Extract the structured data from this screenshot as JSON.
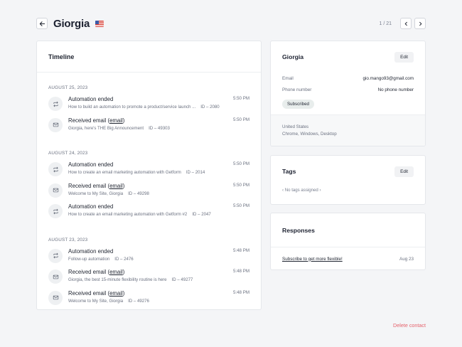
{
  "header": {
    "name": "Giorgia",
    "pager": "1 / 21"
  },
  "icons": {
    "back": "arrow-left-icon",
    "prev": "chevron-left-icon",
    "next": "chevron-right-icon",
    "automation": "repeat-icon",
    "email": "mail-icon",
    "flag": "us-flag-icon"
  },
  "timeline": {
    "title": "Timeline",
    "days": [
      {
        "label": "AUGUST 25, 2023",
        "events": [
          {
            "type": "automation",
            "title": "Automation ended",
            "sub": "How to build an automation to promote a product/service launch ...",
            "id": "ID – 2080",
            "time": "5:50 PM"
          },
          {
            "type": "email",
            "title": "Received email",
            "link": "email",
            "sub": "Giorgia, here's THE Big Announcement",
            "id": "ID – 49303",
            "time": "5:50 PM"
          }
        ]
      },
      {
        "label": "AUGUST 24, 2023",
        "events": [
          {
            "type": "automation",
            "title": "Automation ended",
            "sub": "How to create an email marketing automation with Getform",
            "id": "ID – 2014",
            "time": "5:50 PM"
          },
          {
            "type": "email",
            "title": "Received email",
            "link": "email",
            "sub": "Welcome to My Site, Giorgia",
            "id": "ID – 49298",
            "time": "5:50 PM"
          },
          {
            "type": "automation",
            "title": "Automation ended",
            "sub": "How to create an email marketing automation with Getform #2",
            "id": "ID – 2047",
            "time": "5:50 PM"
          }
        ]
      },
      {
        "label": "AUGUST 23, 2023",
        "events": [
          {
            "type": "automation",
            "title": "Automation ended",
            "sub": "Follow-up automation",
            "id": "ID – 2476",
            "time": "5:48 PM"
          },
          {
            "type": "email",
            "title": "Received email",
            "link": "email",
            "sub": "Giorgia, the best 15-minute flexibility routine is here",
            "id": "ID – 49277",
            "time": "5:48 PM"
          },
          {
            "type": "email",
            "title": "Received email",
            "link": "email",
            "sub": "Welcome to My Site, Giorgia",
            "id": "ID – 49276",
            "time": "5:48 PM"
          },
          {
            "type": "automation",
            "title": "",
            "sub": "",
            "id": "",
            "time": ""
          }
        ]
      }
    ]
  },
  "profile": {
    "name": "Giorgia",
    "edit_label": "Edit",
    "email_label": "Email",
    "email_value": "gio.mango93@gmail.com",
    "phone_label": "Phone number",
    "phone_value": "No phone number",
    "status": "Subscribed",
    "country": "United States",
    "platforms": "Chrome, Windows, Desktop"
  },
  "tags": {
    "title": "Tags",
    "edit_label": "Edit",
    "empty": "‹ No tags assigned ›"
  },
  "responses": {
    "title": "Responses",
    "item": "Subscribe to get more flexible!",
    "date": "Aug 23"
  },
  "footer": {
    "delete_label": "Delete contact"
  },
  "colors": {
    "danger": "#e5616b",
    "pill": "#e8edec",
    "icon_bg": "#eef0f2"
  }
}
